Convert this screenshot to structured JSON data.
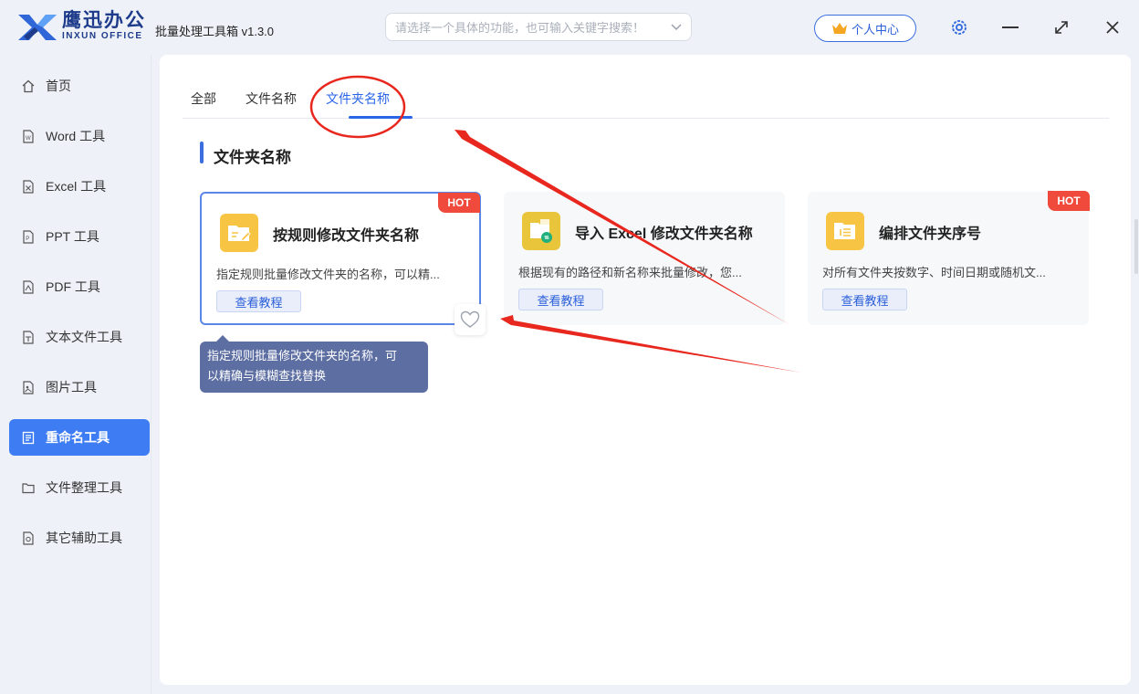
{
  "app": {
    "brand_cn": "鹰迅办公",
    "brand_en": "INXUN OFFICE",
    "title": "批量处理工具箱 v1.3.0"
  },
  "header": {
    "search_placeholder": "请选择一个具体的功能，也可输入关键字搜索！",
    "user_center": "个人中心"
  },
  "sidebar": {
    "items": [
      {
        "label": "首页",
        "icon": "home-icon"
      },
      {
        "label": "Word 工具",
        "icon": "word-file-icon"
      },
      {
        "label": "Excel 工具",
        "icon": "excel-file-icon"
      },
      {
        "label": "PPT 工具",
        "icon": "ppt-file-icon"
      },
      {
        "label": "PDF 工具",
        "icon": "pdf-file-icon"
      },
      {
        "label": "文本文件工具",
        "icon": "text-file-icon"
      },
      {
        "label": "图片工具",
        "icon": "image-file-icon"
      },
      {
        "label": "重命名工具",
        "icon": "rename-icon",
        "active": true
      },
      {
        "label": "文件整理工具",
        "icon": "folder-icon"
      },
      {
        "label": "其它辅助工具",
        "icon": "tools-icon"
      }
    ]
  },
  "tabs": [
    {
      "label": "全部"
    },
    {
      "label": "文件名称"
    },
    {
      "label": "文件夹名称",
      "active": true
    }
  ],
  "section": {
    "title": "文件夹名称"
  },
  "cards": [
    {
      "title": "按规则修改文件夹名称",
      "desc": "指定规则批量修改文件夹的名称，可以精...",
      "button": "查看教程",
      "hot": "HOT",
      "icon": "folder-edit-icon"
    },
    {
      "title": "导入 Excel 修改文件夹名称",
      "desc": "根据现有的路径和新名称来批量修改，您...",
      "button": "查看教程",
      "hot": "",
      "icon": "folder-excel-icon"
    },
    {
      "title": "编排文件夹序号",
      "desc": "对所有文件夹按数字、时间日期或随机文...",
      "button": "查看教程",
      "hot": "HOT",
      "icon": "folder-number-icon"
    }
  ],
  "tooltip": {
    "line1": "指定规则批量修改文件夹的名称，可",
    "line2": "以精确与模糊查找替换"
  },
  "colors": {
    "accent": "#3e7cf4",
    "hot": "#ef4a3c",
    "annotation": "#e8271e"
  }
}
